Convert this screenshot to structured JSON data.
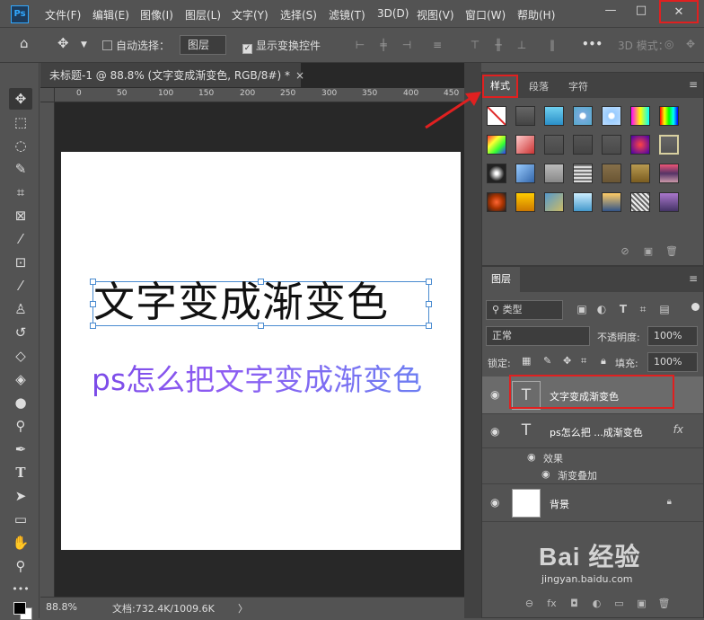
{
  "menubar": {
    "logo": "Ps",
    "items": [
      "文件(F)",
      "编辑(E)",
      "图像(I)",
      "图层(L)",
      "文字(Y)",
      "选择(S)",
      "滤镜(T)",
      "3D(D)",
      "视图(V)",
      "窗口(W)",
      "帮助(H)"
    ],
    "minimize": "—",
    "maximize": "□",
    "close": "✕"
  },
  "options": {
    "auto_select_label": "自动选择：",
    "auto_select_value": "图层",
    "show_transform_label": "显示变换控件",
    "mode_3d_label": "3D 模式：",
    "more": "•••"
  },
  "document": {
    "tab_title": "未标题-1 @ 88.8% (文字变成渐变色, RGB/8#) *",
    "tab_close": "×",
    "ruler_ticks": [
      "0",
      "50",
      "100",
      "150",
      "200",
      "250",
      "300",
      "350",
      "400",
      "450"
    ],
    "text_layer_1": "文字变成渐变色",
    "text_layer_2": "ps怎么把文字变成渐变色",
    "gradient_colors": [
      "#7b4be8",
      "#6d7ef2"
    ]
  },
  "status": {
    "zoom": "88.8%",
    "doc_info": "文档:732.4K/1009.6K",
    "arrow": "〉"
  },
  "styles_panel": {
    "tabs": [
      "样式",
      "段落",
      "字符"
    ],
    "active_tab": "样式",
    "menu": "≡",
    "footer_icons": [
      "⊘",
      "▣",
      "🗑"
    ]
  },
  "layers_panel": {
    "tab": "图层",
    "menu": "≡",
    "filter_label": "类型",
    "blend_mode": "正常",
    "opacity_label": "不透明度:",
    "opacity_value": "100%",
    "lock_label": "锁定:",
    "fill_label": "填充:",
    "fill_value": "100%",
    "layers": [
      {
        "name": "文字变成渐变色",
        "type": "T",
        "selected": true
      },
      {
        "name": "ps怎么把 ...成渐变色",
        "type": "T",
        "selected": false,
        "fx": "fx"
      },
      {
        "name": "背景",
        "type": "image",
        "selected": false
      }
    ],
    "effects_label": "效果",
    "effect_item": "渐变叠加",
    "footer_icons": [
      "⊖",
      "fx",
      "◘",
      "◐",
      "▭",
      "▣",
      "🗑"
    ]
  },
  "watermark": {
    "logo": "Bai 经验",
    "url": "jingyan.baidu.com"
  }
}
